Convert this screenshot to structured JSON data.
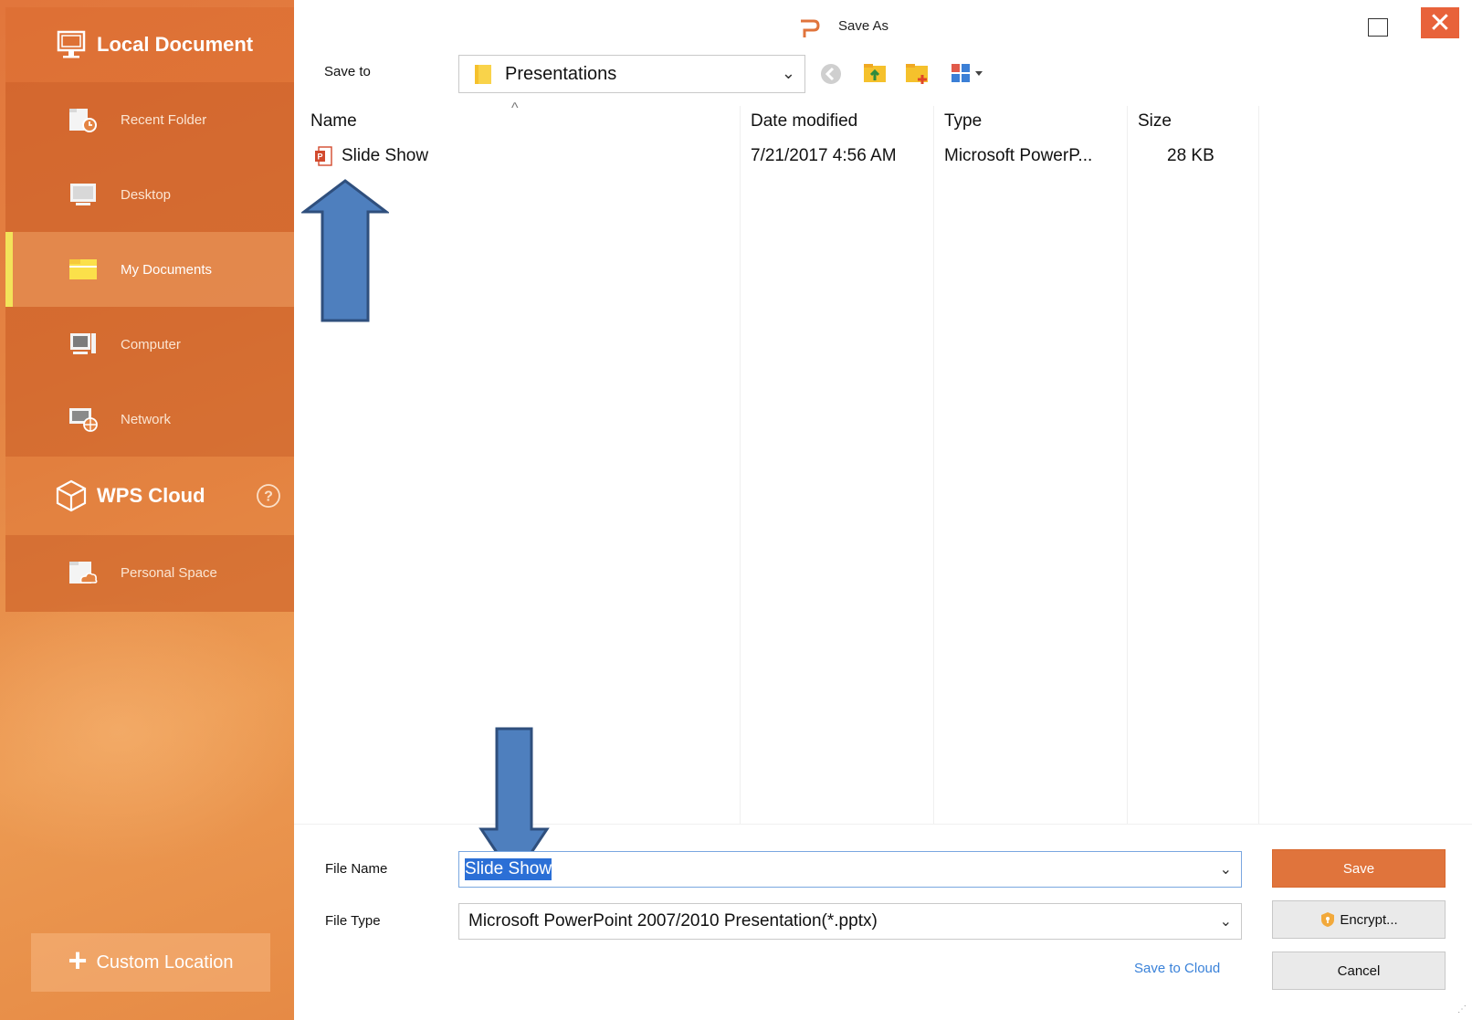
{
  "window": {
    "title": "Save As",
    "close_glyph": "✕"
  },
  "sidebar": {
    "local": {
      "label": "Local Document",
      "icon": "monitor-icon"
    },
    "local_items": [
      {
        "label": "Recent Folder",
        "icon": "recent-folder-icon"
      },
      {
        "label": "Desktop",
        "icon": "desktop-icon"
      },
      {
        "label": "My Documents",
        "icon": "my-documents-icon",
        "active": true
      },
      {
        "label": "Computer",
        "icon": "computer-icon"
      },
      {
        "label": "Network",
        "icon": "network-icon"
      }
    ],
    "cloud": {
      "label": "WPS Cloud",
      "icon": "cube-icon",
      "help": "?"
    },
    "cloud_items": [
      {
        "label": "Personal Space",
        "icon": "personal-space-icon"
      }
    ],
    "custom_location": {
      "plus": "+",
      "label": "Custom Location"
    }
  },
  "toolbar": {
    "save_to_label": "Save to",
    "path": "Presentations",
    "chevron": "⌄"
  },
  "file_list": {
    "sort_indicator": "^",
    "columns": [
      "Name",
      "Date modified",
      "Type",
      "Size"
    ],
    "rows": [
      {
        "name": "Slide Show",
        "date": "7/21/2017 4:56 AM",
        "type": "Microsoft PowerP...",
        "size": "28 KB"
      }
    ]
  },
  "form": {
    "file_name_label": "File Name",
    "file_name_value": "Slide Show",
    "file_type_label": "File Type",
    "file_type_value": "Microsoft PowerPoint 2007/2010 Presentation(*.pptx)",
    "save_button": "Save",
    "encrypt_button": "Encrypt...",
    "cancel_button": "Cancel",
    "save_to_cloud": "Save to Cloud"
  },
  "colors": {
    "accent": "#e0743c",
    "sidebar": "#e48443",
    "highlight": "#2b6fd6",
    "annotation_arrow": "#4e7fbe"
  }
}
